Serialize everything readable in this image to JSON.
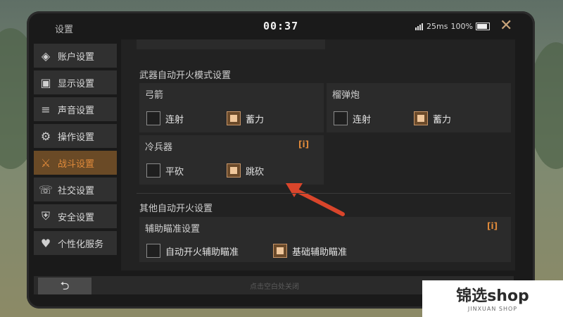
{
  "window": {
    "title": "设置",
    "clock": "00:37",
    "ping": "25ms",
    "battery": "100%",
    "close_icon": "close-icon"
  },
  "sidebar": {
    "items": [
      {
        "label": "账户设置",
        "icon": "account-icon"
      },
      {
        "label": "显示设置",
        "icon": "display-icon"
      },
      {
        "label": "声音设置",
        "icon": "sound-icon"
      },
      {
        "label": "操作设置",
        "icon": "controls-icon"
      },
      {
        "label": "战斗设置",
        "icon": "combat-icon",
        "active": true
      },
      {
        "label": "社交设置",
        "icon": "social-icon"
      },
      {
        "label": "安全设置",
        "icon": "security-icon"
      },
      {
        "label": "个性化服务",
        "icon": "personalization-icon"
      }
    ]
  },
  "content": {
    "section_weapon": "武器自动开火模式设置",
    "bow": {
      "title": "弓箭",
      "opt1": "连射",
      "opt1_checked": false,
      "opt2": "蓄力",
      "opt2_checked": true
    },
    "grenade": {
      "title": "榴弹炮",
      "opt1": "连射",
      "opt1_checked": false,
      "opt2": "蓄力",
      "opt2_checked": true
    },
    "melee": {
      "title": "冷兵器",
      "opt1": "平砍",
      "opt1_checked": false,
      "opt2": "跳砍",
      "opt2_checked": true
    },
    "section_other": "其他自动开火设置",
    "aim": {
      "title": "辅助瞄准设置",
      "opt1": "自动开火辅助瞄准",
      "opt1_checked": false,
      "opt2": "基础辅助瞄准",
      "opt2_checked": true
    },
    "info_label": "i"
  },
  "footer": {
    "back_icon": "back-arrow-icon",
    "hint": "点击空白处关闭"
  },
  "watermark": {
    "name": "锦选shop",
    "sub": "JINXUAN SHOP"
  },
  "colors": {
    "accent": "#e08a3a",
    "active_bg": "#6a4a26",
    "arrow": "#d9452b"
  }
}
